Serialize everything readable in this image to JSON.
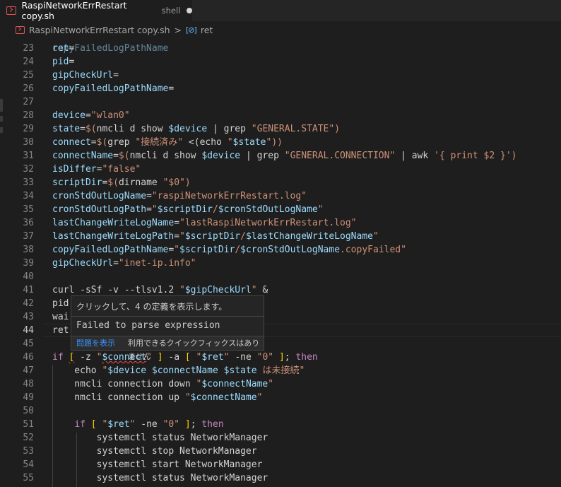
{
  "tab": {
    "title": "RaspiNetworkErrRestart copy.sh",
    "description": "shell",
    "icon": "shell-script-icon"
  },
  "breadcrumb": {
    "file": "RaspiNetworkErrRestart copy.sh",
    "separator": ">",
    "symbol": "ret",
    "symbol_icon": "variable-icon"
  },
  "hover": {
    "header": "クリックして、4 の定義を表示します。",
    "message": "Failed to parse expression",
    "view_problem": "問題を表示",
    "no_quick_fix": "利用できるクイックフィックスはありません"
  },
  "code": {
    "top_partial": "copyFailedLogPathName",
    "lines": [
      {
        "n": "23",
        "text": "ret="
      },
      {
        "n": "24",
        "text": "pid="
      },
      {
        "n": "25",
        "text": "gipCheckUrl="
      },
      {
        "n": "26",
        "text": "copyFailedLogPathName="
      },
      {
        "n": "27",
        "text": ""
      },
      {
        "n": "28",
        "text": "device=\"wlan0\""
      },
      {
        "n": "29",
        "text": "state=$(nmcli d show $device | grep \"GENERAL.STATE\")"
      },
      {
        "n": "30",
        "text": "connect=$(grep \"接続済み\" <(echo \"$state\"))"
      },
      {
        "n": "31",
        "text": "connectName=$(nmcli d show $device | grep \"GENERAL.CONNECTION\" | awk '{ print $2 }')"
      },
      {
        "n": "32",
        "text": "isDiffer=\"false\""
      },
      {
        "n": "33",
        "text": "scriptDir=$(dirname \"$0\")"
      },
      {
        "n": "34",
        "text": "cronStdOutLogName=\"raspiNetworkErrRestart.log\""
      },
      {
        "n": "35",
        "text": "cronStdOutLogPath=\"$scriptDir/$cronStdOutLogName\""
      },
      {
        "n": "36",
        "text": "lastChangeWriteLogName=\"lastRaspiNetworkErrRestart.log\""
      },
      {
        "n": "37",
        "text": "lastChangeWriteLogPath=\"$scriptDir/$lastChangeWriteLogName\""
      },
      {
        "n": "38",
        "text": "copyFailedLogPathName=\"$scriptDir/$cronStdOutLogName.copyFailed\""
      },
      {
        "n": "39",
        "text": "gipCheckUrl=\"inet-ip.info\""
      },
      {
        "n": "40",
        "text": ""
      },
      {
        "n": "41",
        "text": "curl -sSf -v --tlsv1.2 \"$gipCheckUrl\" &"
      },
      {
        "n": "42",
        "text": "pid"
      },
      {
        "n": "43",
        "text": "wai"
      },
      {
        "n": "44",
        "text": "ret"
      },
      {
        "n": "45",
        "text": ""
      },
      {
        "n": "46",
        "text": "if [ -z \"$connect\" ] -a [ \"$ret\" -ne \"0\" ]; then"
      },
      {
        "n": "47",
        "text": "    echo \"$device $connectName $state は未接続\""
      },
      {
        "n": "48",
        "text": "    nmcli connection down \"$connectName\""
      },
      {
        "n": "49",
        "text": "    nmcli connection up \"$connectName\""
      },
      {
        "n": "50",
        "text": ""
      },
      {
        "n": "51",
        "text": "    if [ \"$ret\" -ne \"0\" ]; then"
      },
      {
        "n": "52",
        "text": "        systemctl status NetworkManager"
      },
      {
        "n": "53",
        "text": "        systemctl stop NetworkManager"
      },
      {
        "n": "54",
        "text": "        systemctl start NetworkManager"
      },
      {
        "n": "55",
        "text": "        systemctl status NetworkManager"
      }
    ]
  },
  "colors": {
    "background": "#1e1e1e",
    "variable": "#9cdcfe",
    "string": "#ce9178",
    "keyword": "#c586c0",
    "error": "#f14c4c",
    "link": "#3794ff"
  }
}
